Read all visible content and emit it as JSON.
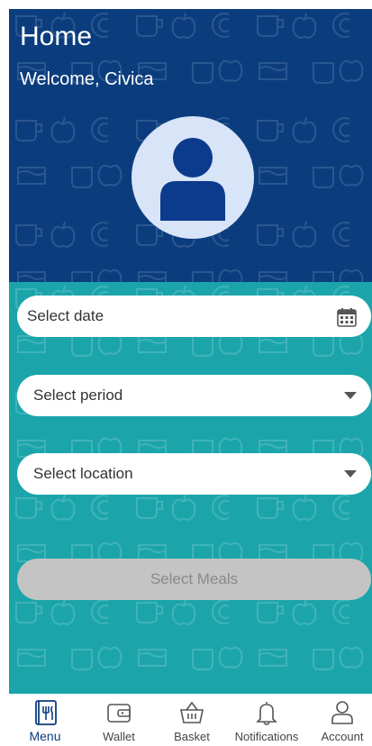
{
  "header": {
    "title": "Home",
    "welcome": "Welcome, Civica"
  },
  "form": {
    "date_placeholder": "Select date",
    "period_placeholder": "Select period",
    "location_placeholder": "Select location",
    "submit_label": "Select Meals"
  },
  "nav": {
    "items": [
      {
        "label": "Menu",
        "icon": "menu-icon",
        "active": true
      },
      {
        "label": "Wallet",
        "icon": "wallet-icon",
        "active": false
      },
      {
        "label": "Basket",
        "icon": "basket-icon",
        "active": false
      },
      {
        "label": "Notifications",
        "icon": "bell-icon",
        "active": false
      },
      {
        "label": "Account",
        "icon": "account-icon",
        "active": false
      }
    ]
  },
  "colors": {
    "header_bg": "#0b3d7e",
    "body_bg": "#1ba5ab",
    "button_disabled": "#c4c4c4",
    "avatar_bg": "#d8e4f8",
    "avatar_fg": "#0c3a8c"
  }
}
